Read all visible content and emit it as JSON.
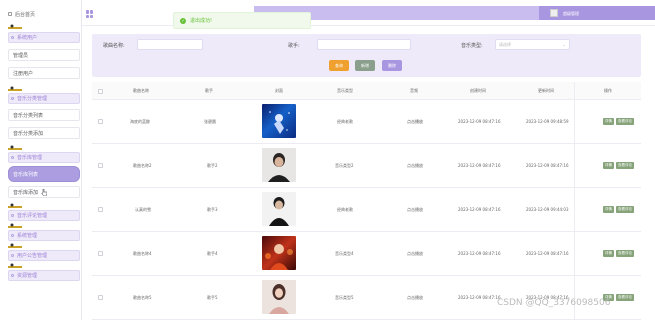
{
  "sidebar": {
    "home_label": "后台首页",
    "groups": [
      {
        "label": "系统用户",
        "items": [
          "管理员",
          "注册用户"
        ]
      },
      {
        "label": "音乐分类管理",
        "items": [
          "音乐分类列表",
          "音乐分类添加"
        ]
      },
      {
        "label": "音乐库管理",
        "items": [
          "音乐库列表",
          "音乐库添加"
        ]
      },
      {
        "label": "音乐评论管理",
        "items": []
      },
      {
        "label": "系统管理",
        "items": []
      },
      {
        "label": "用户公告管理",
        "items": []
      },
      {
        "label": "资源管理",
        "items": []
      }
    ],
    "active_item": "音乐库列表",
    "accent_color": "#ab9de0"
  },
  "header": {
    "user_name": "超级管理",
    "toast_message": "退出成功!"
  },
  "search": {
    "song_label": "歌曲名称:",
    "song_placeholder": "",
    "singer_label": "歌手:",
    "singer_placeholder": "",
    "type_label": "音乐类型:",
    "type_placeholder": "请选择",
    "buttons": {
      "query": "查询",
      "add": "新增",
      "delete": "删除"
    },
    "button_colors": {
      "query": "#f0a02e",
      "add": "#8aa08c",
      "delete": "#a996e0"
    }
  },
  "table": {
    "headers": [
      "歌曲名称",
      "歌手",
      "封面",
      "音乐类型",
      "音频",
      "创建时间",
      "更新时间",
      "操作"
    ],
    "rows": [
      {
        "name": "海底的蓝鲸",
        "singer": "张碧晨",
        "type": "经典老歌",
        "audio": "点击播放",
        "created": "2023-12-09 08:47:16",
        "updated": "2023-12-09 09:48:59"
      },
      {
        "name": "歌曲名称2",
        "singer": "歌手2",
        "type": "音乐类型2",
        "audio": "点击播放",
        "created": "2023-12-09 08:47:16",
        "updated": "2023-12-09 08:47:16"
      },
      {
        "name": "认真的雪",
        "singer": "歌手3",
        "type": "经典老歌",
        "audio": "点击播放",
        "created": "2023-12-09 08:47:16",
        "updated": "2023-12-09 09:44:03"
      },
      {
        "name": "歌曲名称4",
        "singer": "歌手4",
        "type": "音乐类型4",
        "audio": "点击播放",
        "created": "2023-12-09 08:47:16",
        "updated": "2023-12-09 08:47:16"
      },
      {
        "name": "歌曲名称5",
        "singer": "歌手5",
        "type": "音乐类型5",
        "audio": "点击播放",
        "created": "2023-12-09 08:47:16",
        "updated": "2023-12-09 08:47:16"
      }
    ],
    "action_labels": {
      "detail": "详情",
      "comment": "查看评论"
    }
  },
  "watermark": "CSDN @QQ_3376098506"
}
